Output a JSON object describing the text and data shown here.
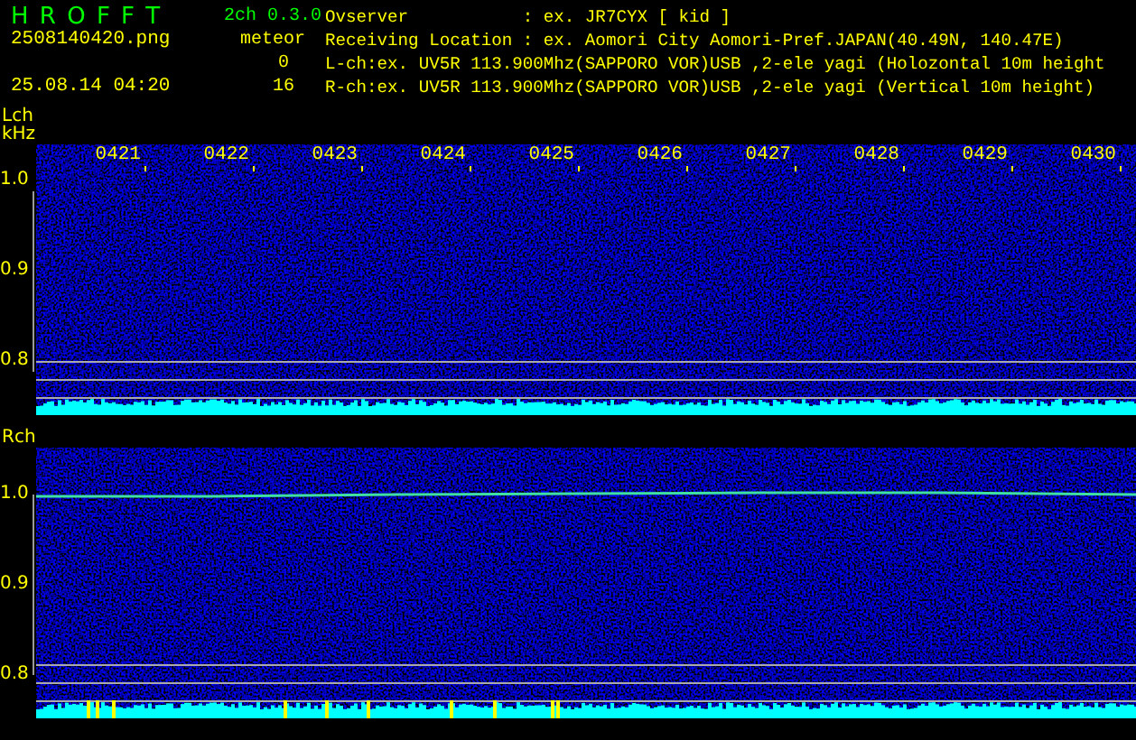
{
  "header": {
    "app_name": "H R O F F T",
    "version": "2ch 0.3.0",
    "file_name": "2508140420.png",
    "timestamp": "25.08.14 04:20",
    "count_label": "meteor",
    "counts": [
      "0",
      "16"
    ],
    "info_lines": [
      "Ovserver           : ex. JR7CYX [ kid ]",
      "Receiving Location : ex. Aomori City Aomori-Pref.JAPAN(40.49N, 140.47E)",
      "L-ch:ex. UV5R 113.900Mhz(SAPPORO VOR)USB ,2-ele yagi (Holozontal 10m height",
      "R-ch:ex. UV5R 113.900Mhz(SAPPORO VOR)USB ,2-ele yagi (Vertical 10m height)"
    ]
  },
  "panels": [
    {
      "channel": "Lch",
      "unit": "kHz",
      "time_ticks": [
        "0421",
        "0422",
        "0423",
        "0424",
        "0425",
        "0426",
        "0427",
        "0428",
        "0429",
        "0430"
      ],
      "freq_ticks": [
        "1.0",
        "0.9",
        "0.8"
      ],
      "signal_trace": false,
      "meteor_marks": false
    },
    {
      "channel": "Rch",
      "freq_ticks": [
        "1.0",
        "0.9",
        "0.8"
      ],
      "signal_trace": true,
      "meteor_marks": true
    }
  ]
}
